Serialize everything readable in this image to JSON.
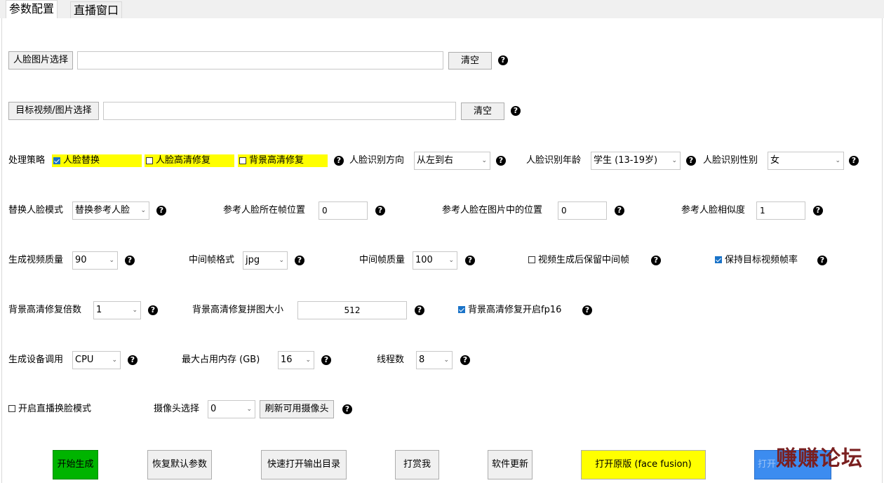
{
  "tabs": [
    "参数配置",
    "直播窗口"
  ],
  "row1": {
    "button": "人脸图片选择",
    "value": "",
    "clear": "清空"
  },
  "row2": {
    "button": "目标视频/图片选择",
    "value": "",
    "clear": "清空"
  },
  "row3": {
    "label": "处理策略",
    "opt1": "人脸替换",
    "opt2": "人脸高清修复",
    "opt3": "背景高清修复",
    "direction_label": "人脸识别方向",
    "direction_value": "从左到右",
    "age_label": "人脸识别年龄",
    "age_value": "学生 (13-19岁)",
    "gender_label": "人脸识别性别",
    "gender_value": "女"
  },
  "row4": {
    "mode_label": "替换人脸模式",
    "mode_value": "替换参考人脸",
    "frame_pos_label": "参考人脸所在帧位置",
    "frame_pos_value": "0",
    "img_pos_label": "参考人脸在图片中的位置",
    "img_pos_value": "0",
    "similarity_label": "参考人脸相似度",
    "similarity_value": "1"
  },
  "row5": {
    "quality_label": "生成视频质量",
    "quality_value": "90",
    "format_label": "中间帧格式",
    "format_value": "jpg",
    "frame_quality_label": "中间帧质量",
    "frame_quality_value": "100",
    "keep_frames_label": "视频生成后保留中间帧",
    "keep_fps_label": "保持目标视频帧率"
  },
  "row6": {
    "scale_label": "背景高清修复倍数",
    "scale_value": "1",
    "tile_label": "背景高清修复拼图大小",
    "tile_value": "512",
    "fp16_label": "背景高清修复开启fp16"
  },
  "row7": {
    "device_label": "生成设备调用",
    "device_value": "CPU",
    "memory_label": "最大占用内存 (GB)",
    "memory_value": "16",
    "threads_label": "线程数",
    "threads_value": "8"
  },
  "row8": {
    "live_label": "开启直播换脸模式",
    "camera_label": "摄像头选择",
    "camera_value": "0",
    "refresh_label": "刷新可用摄像头"
  },
  "actions": {
    "start": "开始生成",
    "reset": "恢复默认参数",
    "open_output": "快速打开输出目录",
    "donate": "打赏我",
    "update": "软件更新",
    "open_original": "打开原版 (face fusion)",
    "last": "打开"
  },
  "watermark": "赚赚论坛",
  "help_glyph": "?",
  "chev_glyph": "⌄",
  "colors": {
    "start_green": "#00b400",
    "highlight_yellow": "#ffff00",
    "blue": "#3c8cf0",
    "watermark": "#7a2020"
  }
}
